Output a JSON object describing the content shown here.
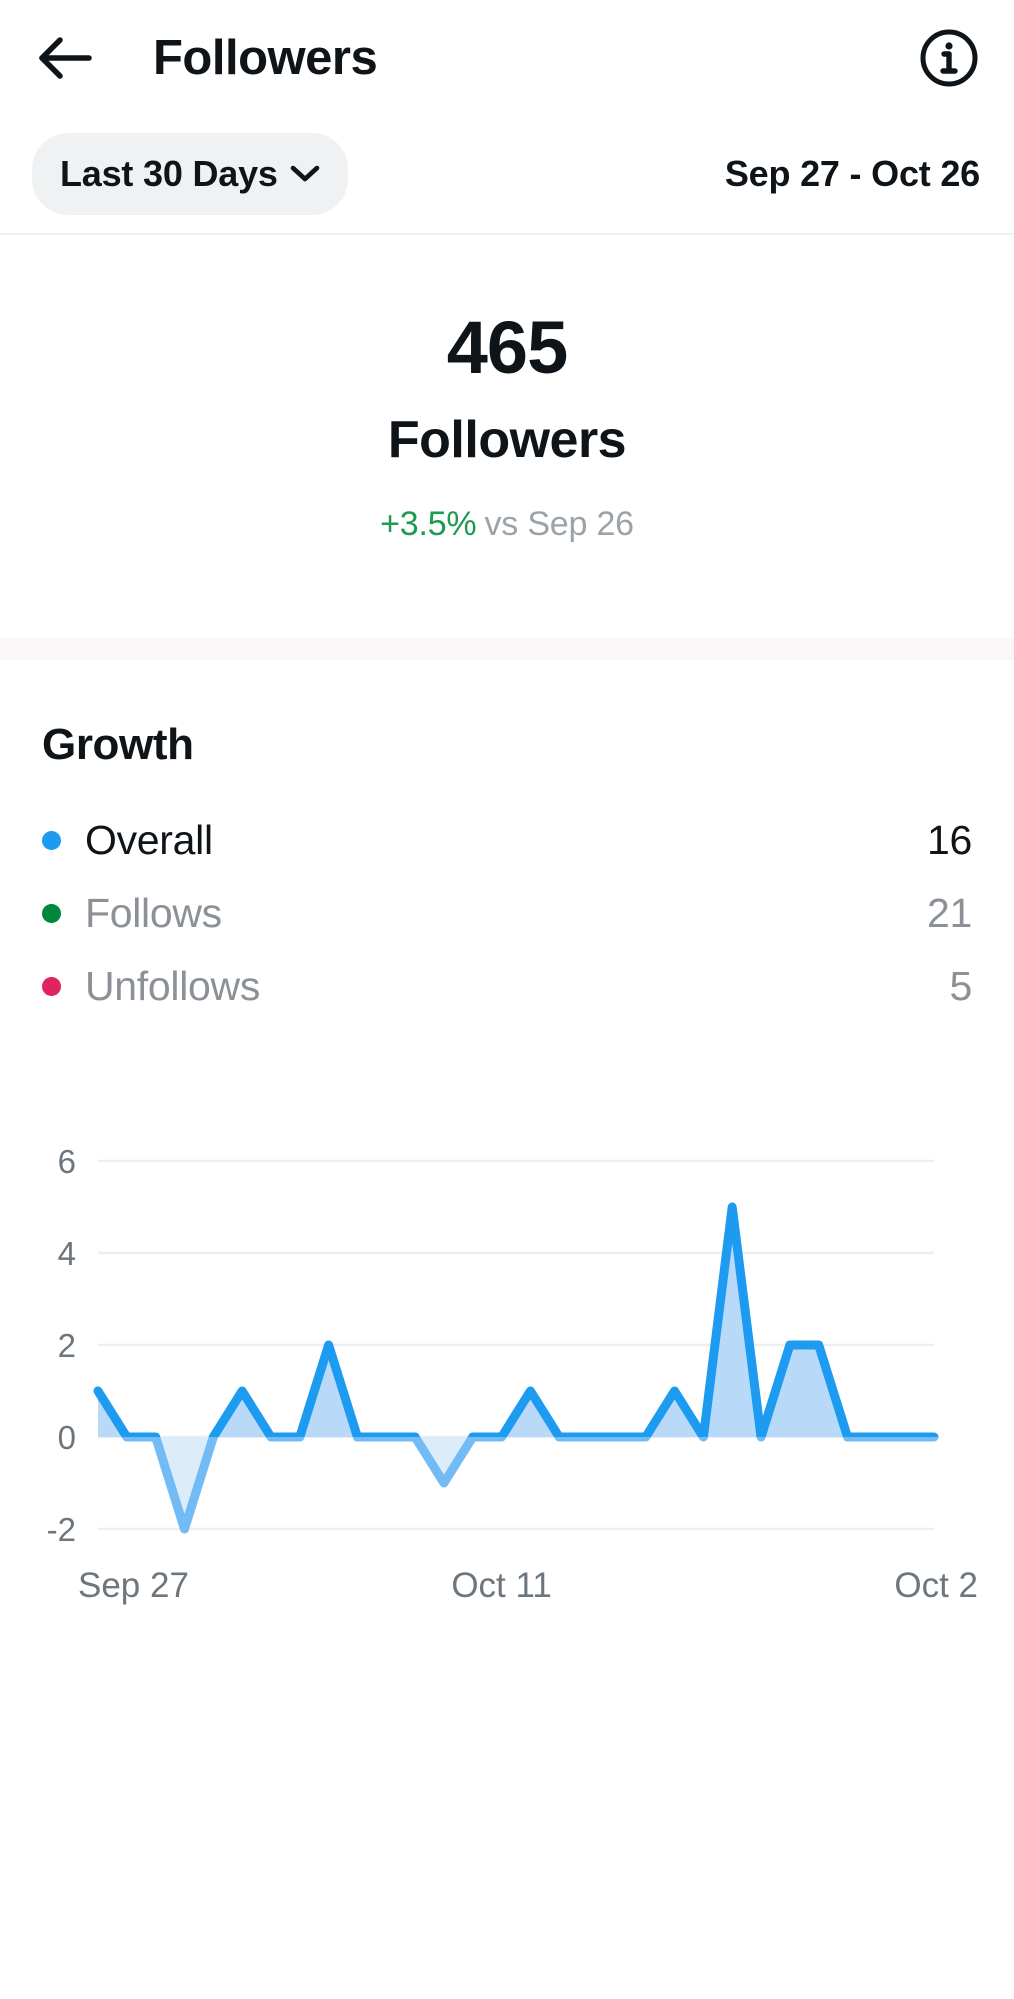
{
  "header": {
    "back_icon": "arrow-left-icon",
    "title": "Followers",
    "info_icon": "info-circle-icon"
  },
  "filters": {
    "range_label": "Last 30 Days",
    "chevron_icon": "chevron-down-icon",
    "date_range": "Sep 27 - Oct 26"
  },
  "hero": {
    "value": "465",
    "label": "Followers",
    "delta_pct": "+3.5%",
    "delta_compare": "vs Sep 26",
    "delta_color": "#1d9b52"
  },
  "growth": {
    "title": "Growth",
    "items": [
      {
        "label": "Overall",
        "value": "16",
        "color": "#1d9bf0"
      },
      {
        "label": "Follows",
        "value": "21",
        "color": "#00873c"
      },
      {
        "label": "Unfollows",
        "value": "5",
        "color": "#e0245e"
      }
    ]
  },
  "chart_data": {
    "type": "area",
    "title": "Growth",
    "xlabel": "",
    "ylabel": "",
    "ylim": [
      -2,
      6
    ],
    "yticks": [
      6,
      4,
      2,
      0,
      -2
    ],
    "ytick_labels": [
      "6",
      "4",
      "2",
      "0",
      "-2"
    ],
    "xtick_labels": [
      "Sep 27",
      "Oct 11",
      "Oct 2"
    ],
    "xtick_positions": [
      0,
      14,
      29
    ],
    "grid": true,
    "legend_position": "above",
    "line_color": "#1d9bf0",
    "fill_color_positive": "#b8daf8",
    "fill_color_negative": "#dbecfb",
    "categories": [
      "Sep 27",
      "Sep 28",
      "Sep 29",
      "Sep 30",
      "Oct 1",
      "Oct 2",
      "Oct 3",
      "Oct 4",
      "Oct 5",
      "Oct 6",
      "Oct 7",
      "Oct 8",
      "Oct 9",
      "Oct 10",
      "Oct 11",
      "Oct 12",
      "Oct 13",
      "Oct 14",
      "Oct 15",
      "Oct 16",
      "Oct 17",
      "Oct 18",
      "Oct 19",
      "Oct 20",
      "Oct 21",
      "Oct 22",
      "Oct 23",
      "Oct 24",
      "Oct 25",
      "Oct 26"
    ],
    "series": [
      {
        "name": "Overall",
        "values": [
          1,
          0,
          0,
          -2,
          0,
          1,
          0,
          0,
          2,
          0,
          0,
          0,
          -1,
          0,
          0,
          1,
          0,
          0,
          0,
          0,
          1,
          0,
          5,
          0,
          2,
          2,
          0,
          0,
          0,
          0
        ]
      }
    ]
  }
}
